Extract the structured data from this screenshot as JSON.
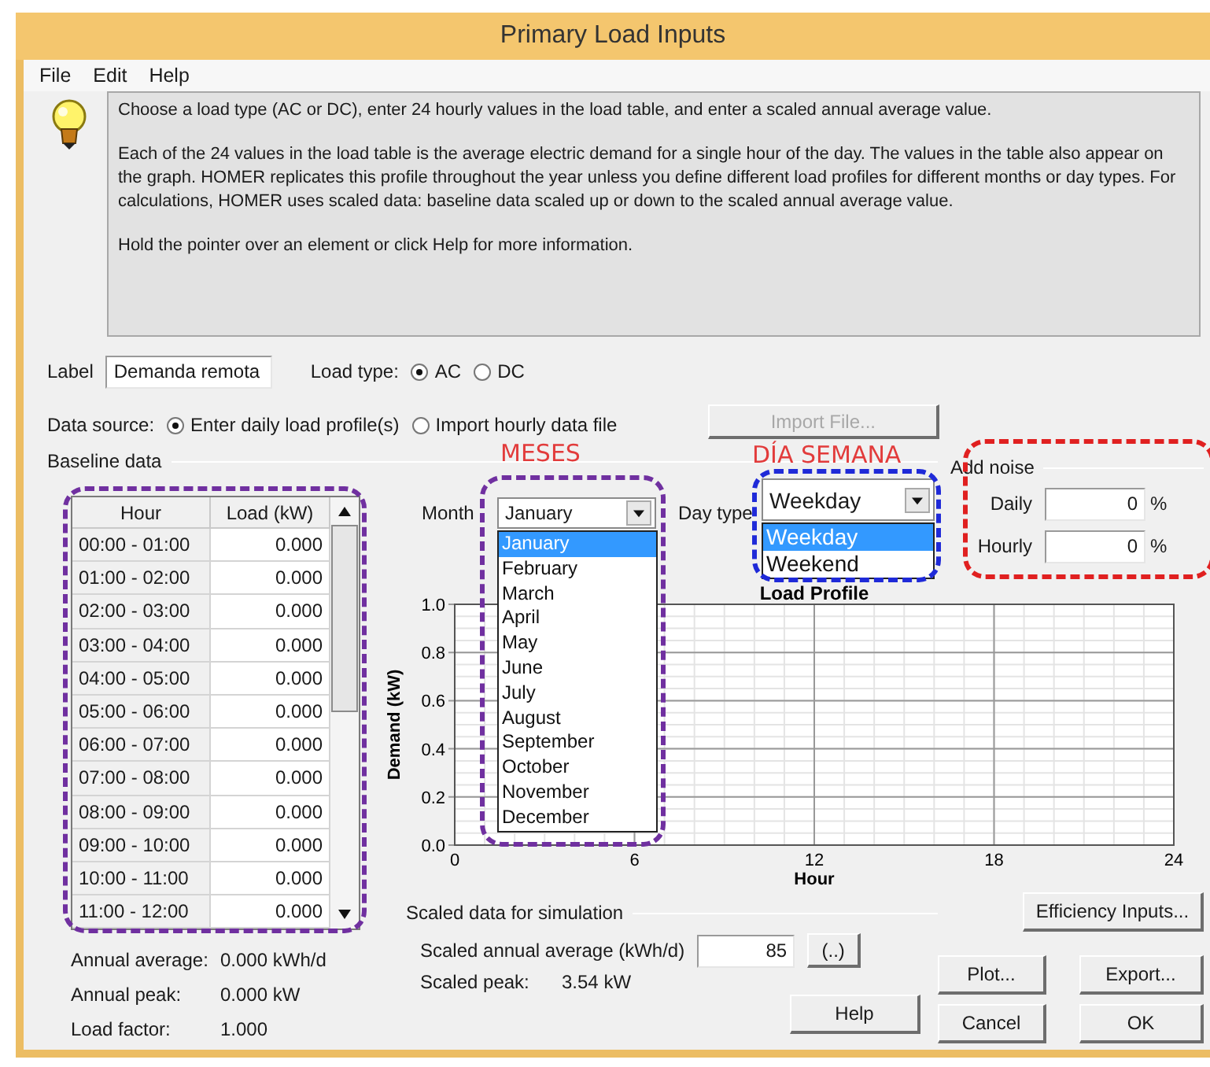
{
  "window": {
    "title": "Primary Load Inputs"
  },
  "menu": [
    "File",
    "Edit",
    "Help"
  ],
  "info": {
    "paragraphs": [
      "Choose a load type (AC or DC), enter 24 hourly values in the load table, and enter a scaled annual average value.",
      "Each of the 24 values in the load table is the average electric demand for a single hour of the day. The values in the table also appear on the graph. HOMER replicates this profile throughout the year unless you define different load profiles for different months or day types. For calculations, HOMER uses scaled data: baseline data scaled up or down to the scaled annual average value.",
      "Hold the pointer over an element or click Help for more information."
    ]
  },
  "label_field": {
    "label": "Label",
    "value": "Demanda remota"
  },
  "load_type": {
    "label": "Load type:",
    "options": [
      {
        "label": "AC",
        "selected": true
      },
      {
        "label": "DC",
        "selected": false
      }
    ]
  },
  "data_source": {
    "label": "Data source:",
    "options": [
      {
        "label": "Enter daily load profile(s)",
        "selected": true
      },
      {
        "label": "Import hourly data file",
        "selected": false
      }
    ]
  },
  "import_button": {
    "label": "Import File...",
    "disabled": true
  },
  "baseline": {
    "title": "Baseline data",
    "columns": [
      "Hour",
      "Load (kW)"
    ],
    "rows": [
      [
        "00:00 - 01:00",
        "0.000"
      ],
      [
        "01:00 - 02:00",
        "0.000"
      ],
      [
        "02:00 - 03:00",
        "0.000"
      ],
      [
        "03:00 - 04:00",
        "0.000"
      ],
      [
        "04:00 - 05:00",
        "0.000"
      ],
      [
        "05:00 - 06:00",
        "0.000"
      ],
      [
        "06:00 - 07:00",
        "0.000"
      ],
      [
        "07:00 - 08:00",
        "0.000"
      ],
      [
        "08:00 - 09:00",
        "0.000"
      ],
      [
        "09:00 - 10:00",
        "0.000"
      ],
      [
        "10:00 - 11:00",
        "0.000"
      ],
      [
        "11:00 - 12:00",
        "0.000"
      ]
    ],
    "stats": [
      {
        "label": "Annual average:",
        "value": "0.000 kWh/d"
      },
      {
        "label": "Annual peak:",
        "value": "0.000 kW"
      },
      {
        "label": "Load factor:",
        "value": "1.000"
      }
    ]
  },
  "month": {
    "label": "Month",
    "value": "January",
    "options": [
      {
        "label": "January",
        "selected": true
      },
      {
        "label": "February",
        "selected": false
      },
      {
        "label": "March",
        "selected": false
      },
      {
        "label": "April",
        "selected": false
      },
      {
        "label": "May",
        "selected": false
      },
      {
        "label": "June",
        "selected": false
      },
      {
        "label": "July",
        "selected": false
      },
      {
        "label": "August",
        "selected": false
      },
      {
        "label": "September",
        "selected": false
      },
      {
        "label": "October",
        "selected": false
      },
      {
        "label": "November",
        "selected": false
      },
      {
        "label": "December",
        "selected": false
      }
    ]
  },
  "day_type": {
    "label": "Day type",
    "value": "Weekday",
    "options": [
      {
        "label": "Weekday",
        "selected": true
      },
      {
        "label": "Weekend",
        "selected": false
      }
    ]
  },
  "noise": {
    "title": "Add noise",
    "fields": [
      {
        "label": "Daily",
        "value": "0",
        "unit": "%"
      },
      {
        "label": "Hourly",
        "value": "0",
        "unit": "%"
      }
    ]
  },
  "chart": {
    "chart_data": {
      "type": "line",
      "grid": true,
      "title": "Load Profile",
      "xlabel": "Hour",
      "ylabel": "Demand (kW)",
      "xlim": [
        0,
        24
      ],
      "ylim": [
        0,
        1
      ],
      "xticks": [
        0,
        6,
        12,
        18,
        24
      ],
      "yticks": [
        {
          "value": 0,
          "label": "0.0"
        },
        {
          "value": 0.2,
          "label": "0.2"
        },
        {
          "value": 0.4,
          "label": "0.4"
        },
        {
          "value": 0.6,
          "label": "0.6"
        },
        {
          "value": 0.8,
          "label": "0.8"
        },
        {
          "value": 1,
          "label": "1.0"
        }
      ]
    }
  },
  "scaled": {
    "title": "Scaled data for simulation",
    "average_label": "Scaled annual average (kWh/d)",
    "average_value": "85",
    "more_button": "(..)",
    "peak_label": "Scaled peak:",
    "peak_value": "3.54 kW"
  },
  "buttons": {
    "efficiency": "Efficiency Inputs...",
    "plot": "Plot...",
    "export": "Export...",
    "help": "Help",
    "cancel": "Cancel",
    "ok": "OK"
  },
  "annotations": {
    "labels": [
      "MESES",
      "DÍA SEMANA"
    ],
    "frames": [
      {
        "color": "#7030a0"
      },
      {
        "color": "#7030a0"
      },
      {
        "color": "#1f2ad8"
      },
      {
        "color": "#e02020"
      }
    ]
  }
}
